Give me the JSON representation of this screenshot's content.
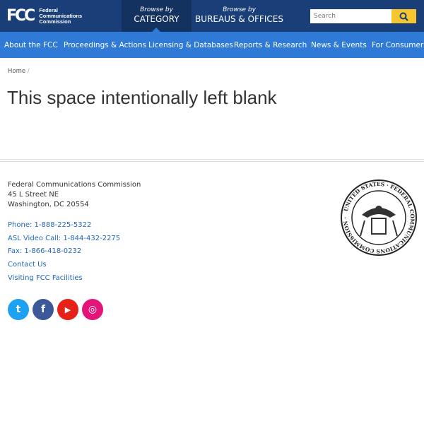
{
  "header": {
    "logo_mark": "FCC",
    "logo_lines": [
      "Federal",
      "Communications",
      "Commission"
    ],
    "browse": [
      {
        "small": "Browse by",
        "big": "CATEGORY"
      },
      {
        "small": "Browse by",
        "big": "BUREAUS & OFFICES"
      }
    ],
    "search_placeholder": "Search"
  },
  "nav": [
    "About the FCC",
    "Proceedings & Actions",
    "Licensing & Databases",
    "Reports & Research",
    "News & Events",
    "For Consumers"
  ],
  "breadcrumb": {
    "home": "Home",
    "sep": "/"
  },
  "page_title": "This space intentionally left blank",
  "footer": {
    "address": [
      "Federal Communications Commission",
      "45 L Street NE",
      "Washington, DC 20554"
    ],
    "links": [
      "Phone: 1-888-225-5322",
      "ASL Video Call: 1-844-432-2275",
      "Fax: 1-866-418-0232",
      "Contact Us",
      "Visiting FCC Facilities"
    ],
    "social": [
      {
        "name": "twitter",
        "color": "#1da1f2",
        "glyph": "t"
      },
      {
        "name": "facebook",
        "color": "#3b5998",
        "glyph": "f"
      },
      {
        "name": "youtube",
        "color": "#e62117",
        "glyph": "▶"
      },
      {
        "name": "instagram",
        "color": "#e4157a",
        "glyph": "◎"
      }
    ],
    "seal_text": "UNITED STATES · FEDERAL COMMUNICATIONS COMMISSION"
  },
  "colors": {
    "header": "#1a3f78",
    "nav": "#2f7ad6",
    "search_button": "#f7c52e",
    "link": "#2366b8"
  }
}
